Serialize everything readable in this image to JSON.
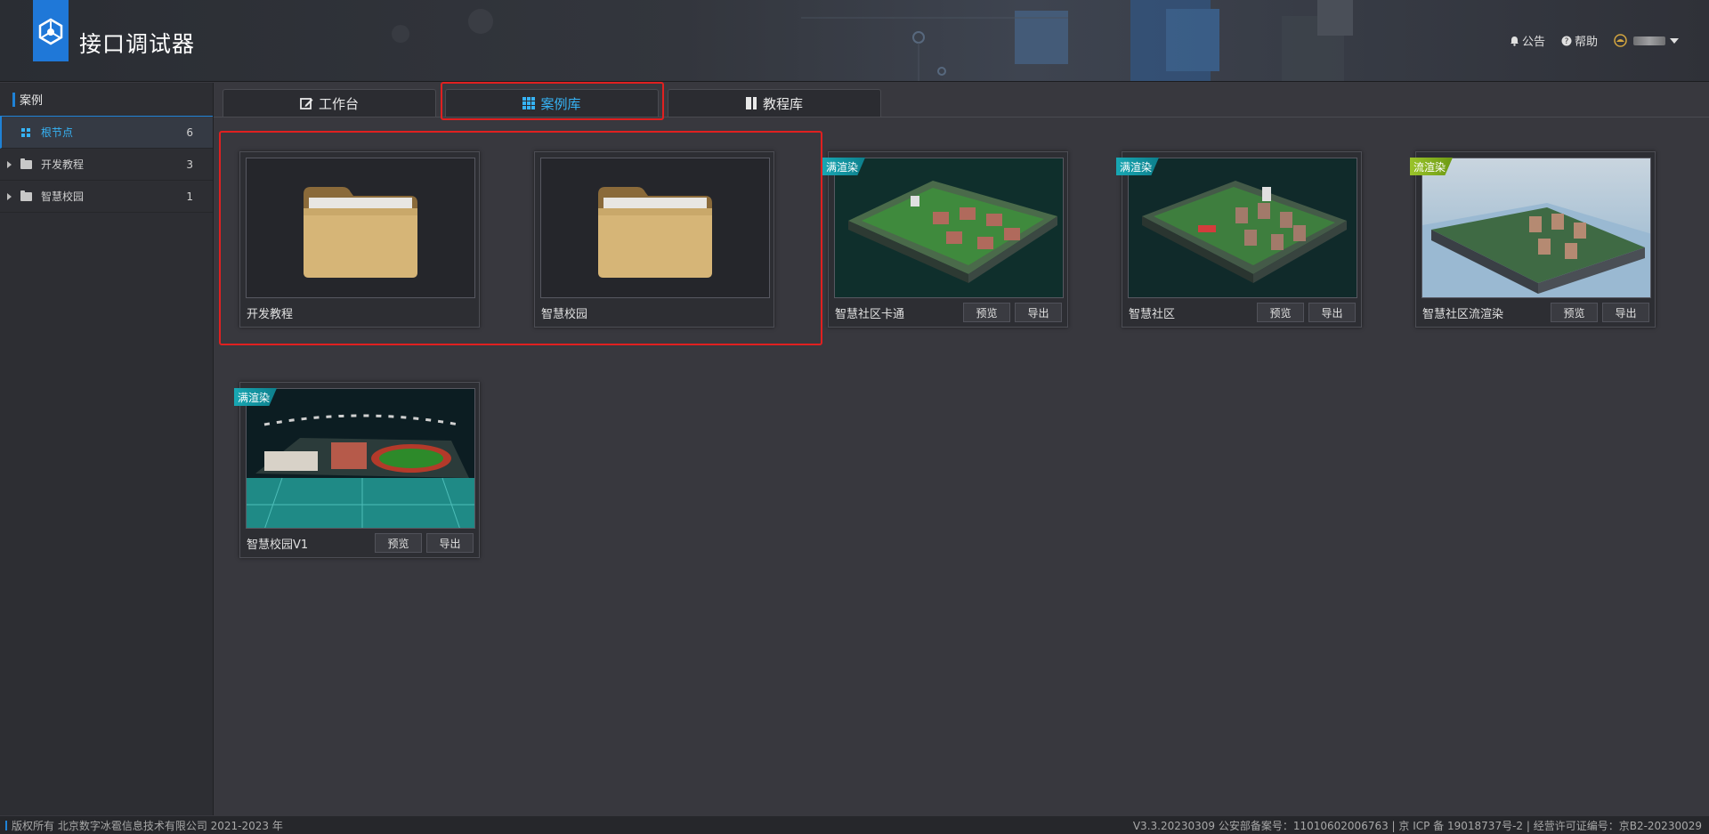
{
  "header": {
    "app_title": "接口调试器",
    "announcement": "公告",
    "help": "帮助"
  },
  "sidebar": {
    "title": "案例",
    "items": [
      {
        "label": "根节点",
        "count": "6"
      },
      {
        "label": "开发教程",
        "count": "3"
      },
      {
        "label": "智慧校园",
        "count": "1"
      }
    ]
  },
  "tabs": [
    {
      "label": "工作台",
      "icon": "edit-icon"
    },
    {
      "label": "案例库",
      "icon": "grid-icon"
    },
    {
      "label": "教程库",
      "icon": "book-icon"
    }
  ],
  "folders": [
    {
      "name": "开发教程"
    },
    {
      "name": "智慧校园"
    }
  ],
  "cases": [
    {
      "name": "智慧社区卡通",
      "badge": "满渲染",
      "preview": "预览",
      "export": "导出"
    },
    {
      "name": "智慧社区",
      "badge": "满渲染",
      "preview": "预览",
      "export": "导出"
    },
    {
      "name": "智慧社区流渲染",
      "badge": "流渲染",
      "preview": "预览",
      "export": "导出"
    },
    {
      "name": "智慧校园V1",
      "badge": "满渲染",
      "preview": "预览",
      "export": "导出"
    }
  ],
  "footer": {
    "copyright": "版权所有 北京数字冰雹信息技术有限公司 2021-2023 年",
    "version_info": "V3.3.20230309 公安部备案号：11010602006763 | 京 ICP 备 19018737号-2 | 经营许可证编号：京B2-20230029"
  },
  "colors": {
    "accent": "#1f82d6",
    "active_text": "#36b3f5",
    "highlight_outline": "#e02020"
  }
}
